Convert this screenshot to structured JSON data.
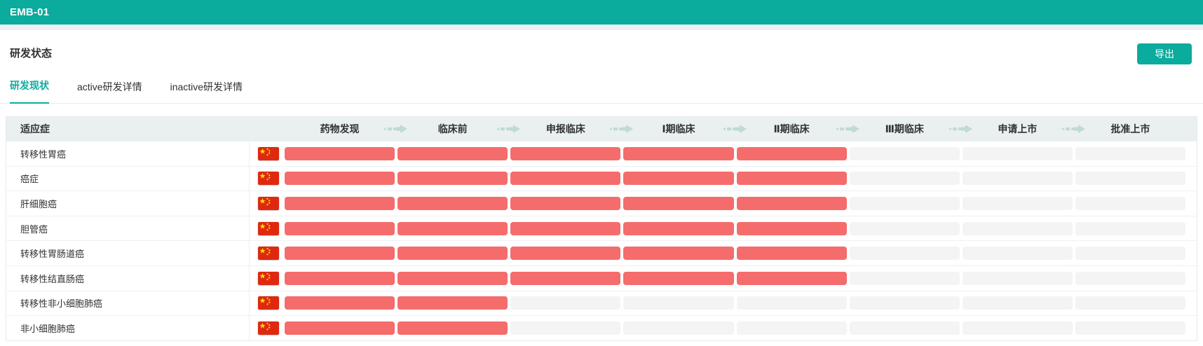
{
  "app_bar": {
    "title": "EMB-01"
  },
  "section": {
    "title": "研发状态",
    "export_label": "导出"
  },
  "tabs": [
    {
      "label": "研发现状",
      "active": true
    },
    {
      "label": "active研发详情",
      "active": false
    },
    {
      "label": "inactive研发详情",
      "active": false
    }
  ],
  "pipeline_table": {
    "indication_header": "适应症",
    "stages": [
      "药物发现",
      "临床前",
      "申报临床",
      "Ⅰ期临床",
      "Ⅱ期临床",
      "Ⅲ期临床",
      "申请上市",
      "批准上市"
    ],
    "rows": [
      {
        "indication": "转移性胃癌",
        "region_icon": "china-flag",
        "stages_reached": 5
      },
      {
        "indication": "癌症",
        "region_icon": "china-flag",
        "stages_reached": 5
      },
      {
        "indication": "肝细胞癌",
        "region_icon": "china-flag",
        "stages_reached": 5
      },
      {
        "indication": "胆管癌",
        "region_icon": "china-flag",
        "stages_reached": 5
      },
      {
        "indication": "转移性胃肠道癌",
        "region_icon": "china-flag",
        "stages_reached": 5
      },
      {
        "indication": "转移性结直肠癌",
        "region_icon": "china-flag",
        "stages_reached": 5
      },
      {
        "indication": "转移性非小细胞肺癌",
        "region_icon": "china-flag",
        "stages_reached": 2
      },
      {
        "indication": "非小细胞肺癌",
        "region_icon": "china-flag",
        "stages_reached": 2
      }
    ]
  },
  "colors": {
    "accent_teal": "#0bab9d",
    "bar_active": "#f56c6c",
    "bar_inactive": "#f4f4f5",
    "header_bg": "#e9f0ef",
    "arrow": "#c0dad5",
    "flag_red": "#de2910",
    "flag_yellow": "#ffde00"
  }
}
